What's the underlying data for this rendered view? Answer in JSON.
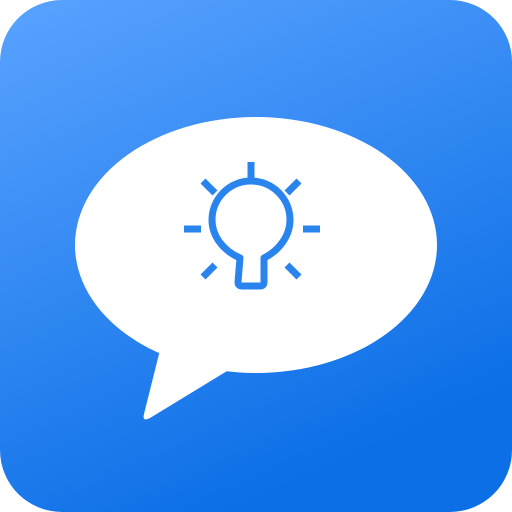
{
  "app_icon": {
    "icon_name": "chat-bubble-lightbulb-icon",
    "colors": {
      "background_gradient_top": "#5AA3FF",
      "background_gradient_bottom": "#0C6FE6",
      "bubble_fill": "#FFFFFF",
      "lightbulb_stroke": "#2A84EE"
    }
  }
}
